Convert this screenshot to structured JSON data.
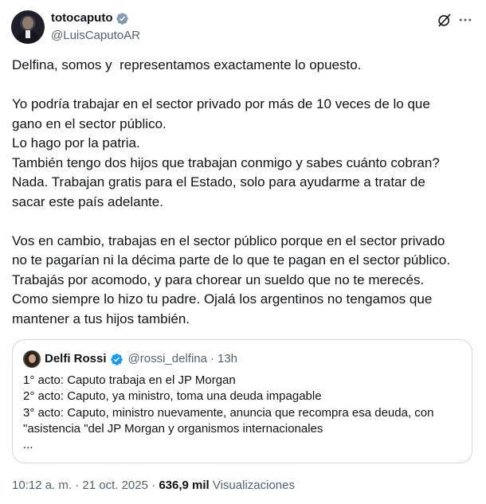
{
  "author": {
    "display_name": "totocaputo",
    "handle": "@LuisCaputoAR",
    "verified_color": "#829aab"
  },
  "actions": {
    "grok_icon": "grok-slash-circle-icon",
    "more_icon": "more-horizontal-icon"
  },
  "text_lines": [
    "Delfina, somos y  representamos exactamente lo opuesto.",
    "",
    "Yo podría trabajar en el sector privado por más de 10 veces de lo que",
    "gano en el sector público.",
    "Lo hago por la patria.",
    "También tengo dos hijos que trabajan conmigo y sabes cuánto cobran?",
    "Nada. Trabajan gratis para el Estado, solo para ayudarme a tratar de",
    "sacar este país adelante.",
    "",
    "Vos en cambio, trabajas en el sector público porque en el sector privado",
    "no te pagarían ni la décima parte de lo que te pagan en el sector público.",
    "Trabajás por acomodo, y para chorear un sueldo que no te merecés.",
    "Como siempre lo hizo tu padre. Ojalá los argentinos no tengamos que",
    "mantener a tus hijos también."
  ],
  "quote": {
    "display_name": "Delfi Rossi",
    "handle": "@rossi_delfina",
    "separator": "·",
    "time": "13h",
    "verified_color": "#1d9bf0",
    "lines": [
      "1° acto: Caputo trabaja en el JP Morgan",
      "2° acto: Caputo, ya ministro, toma una deuda impagable",
      "3° acto: Caputo, ministro nuevamente, anuncia que recompra esa deuda, con",
      "\"asistencia \"del JP Morgan y organismos internacionales",
      "..."
    ]
  },
  "meta": {
    "time": "10:12 a. m.",
    "sep1": " · ",
    "date": "21 oct. 2025",
    "sep2": " · ",
    "views_count": "636,9 mil",
    "views_label": " Visualizaciones"
  },
  "colors": {
    "text": "#0f1419",
    "secondary": "#536471",
    "border": "#cfd9de"
  }
}
